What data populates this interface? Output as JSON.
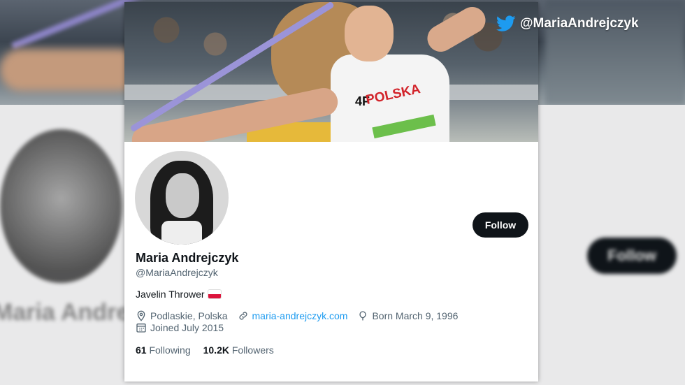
{
  "watermark": {
    "handle": "@MariaAndrejczyk",
    "icon": "twitter-bird-icon",
    "color": "#1d9bf0"
  },
  "profile": {
    "banner_shirt_text": "POLSKA",
    "banner_shirt_brand": "4F",
    "name": "Maria Andrejczyk",
    "handle": "@MariaAndrejczyk",
    "bio": "Javelin Thrower",
    "bio_flag": "poland-flag",
    "location": "Podlaskie, Polska",
    "website": "maria-andrejczyk.com",
    "birthday": "Born March 9, 1996",
    "joined": "Joined July 2015",
    "following_count": "61",
    "following_label": "Following",
    "followers_count": "10.2K",
    "followers_label": "Followers"
  },
  "actions": {
    "follow_label": "Follow"
  },
  "background": {
    "blurred_name": "Maria Andrejczyk",
    "blurred_follow": "Follow"
  },
  "colors": {
    "accent": "#1d9bf0",
    "button_bg": "#0f1419",
    "secondary_text": "#536471"
  }
}
